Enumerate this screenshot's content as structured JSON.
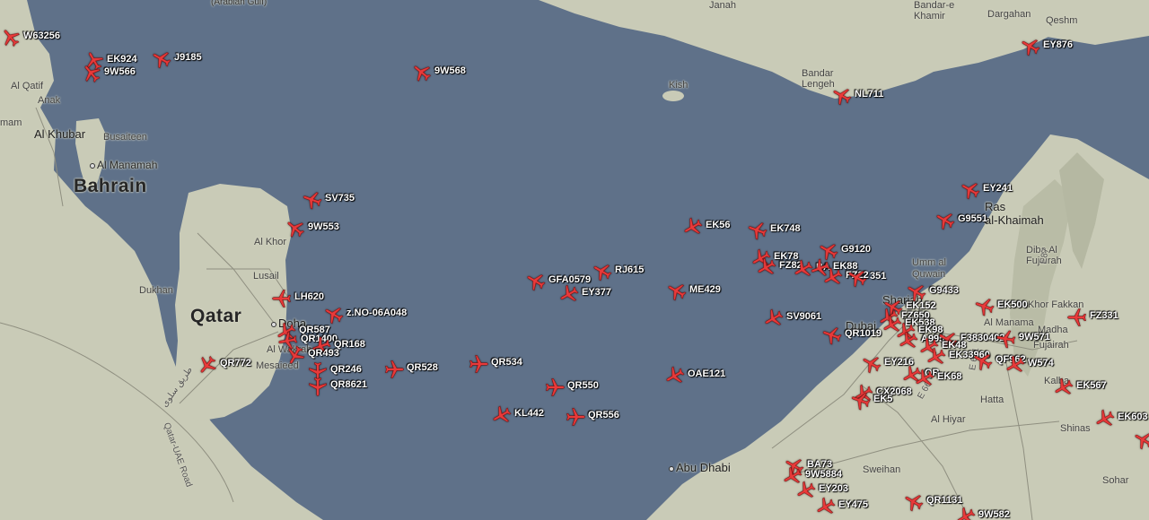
{
  "map": {
    "colors": {
      "water": "#5f7189",
      "land": "#c9cbb7",
      "plane": "#e83a3a",
      "label": "#ffffff"
    }
  },
  "places": [
    {
      "id": "arabian-gulf",
      "text": "(Arabian Gulf)",
      "cls": "sea"
    },
    {
      "id": "janah",
      "text": "Janah",
      "cls": "small"
    },
    {
      "id": "bandar-khamir",
      "text": "Bandar-e\nKhamir",
      "cls": "small"
    },
    {
      "id": "dargahan",
      "text": "Dargahan",
      "cls": "small"
    },
    {
      "id": "qeshm",
      "text": "Qeshm",
      "cls": "small"
    },
    {
      "id": "bandar-lengeh",
      "text": "Bandar\nLengeh",
      "cls": "small"
    },
    {
      "id": "kish",
      "text": "Kish",
      "cls": "small"
    },
    {
      "id": "al-qatif",
      "text": "Al Qatif",
      "cls": "small"
    },
    {
      "id": "anak",
      "text": "Anak",
      "cls": "small"
    },
    {
      "id": "mam",
      "text": "mam",
      "cls": "small"
    },
    {
      "id": "al-khubar",
      "text": "Al Khubar",
      "cls": "big"
    },
    {
      "id": "busaiteen",
      "text": "Busaiteen",
      "cls": "small"
    },
    {
      "id": "al-manamah",
      "text": "Al Manamah",
      "cls": "dot"
    },
    {
      "id": "bahrain",
      "text": "Bahrain",
      "cls": "country"
    },
    {
      "id": "al-khor",
      "text": "Al Khor",
      "cls": "small"
    },
    {
      "id": "lusail",
      "text": "Lusail",
      "cls": "small"
    },
    {
      "id": "dukhan",
      "text": "Dukhan",
      "cls": "small"
    },
    {
      "id": "qatar",
      "text": "Qatar",
      "cls": "country"
    },
    {
      "id": "doha",
      "text": "Doha",
      "cls": "dot"
    },
    {
      "id": "al-wakrah",
      "text": "Al Wakrah",
      "cls": "small"
    },
    {
      "id": "mesaieed",
      "text": "Mesaieed",
      "cls": "small"
    },
    {
      "id": "qatar-uae-road",
      "text": "Qatar-UAE Road",
      "cls": "road"
    },
    {
      "id": "arabic-road",
      "text": "طريق سلوى",
      "cls": "road"
    },
    {
      "id": "ras-al-khaimah",
      "text": "Ras\nal-Khaimah",
      "cls": "big"
    },
    {
      "id": "umm-al",
      "text": "Umm al\nQuwain",
      "cls": "small"
    },
    {
      "id": "dibba",
      "text": "Diba Al\nFujairah",
      "cls": "small"
    },
    {
      "id": "sharjah",
      "text": "Sharjah",
      "cls": "big"
    },
    {
      "id": "dubai",
      "text": "Dubai",
      "cls": "big"
    },
    {
      "id": "khor-fakkan",
      "text": "Khor Fakkan",
      "cls": "small"
    },
    {
      "id": "madha",
      "text": "Madha",
      "cls": "small"
    },
    {
      "id": "al-manama-uae",
      "text": "Al Manama",
      "cls": "small"
    },
    {
      "id": "fujairah",
      "text": "Fujairah",
      "cls": "small"
    },
    {
      "id": "kalba",
      "text": "Kalba",
      "cls": "small"
    },
    {
      "id": "hatta",
      "text": "Hatta",
      "cls": "small"
    },
    {
      "id": "shinas",
      "text": "Shinas",
      "cls": "small"
    },
    {
      "id": "sohar",
      "text": "Sohar",
      "cls": "small"
    },
    {
      "id": "abu-dhabi",
      "text": "Abu Dhabi",
      "cls": "dot big"
    },
    {
      "id": "al-hiyar",
      "text": "Al Hiyar",
      "cls": "small"
    },
    {
      "id": "sweihan",
      "text": "Sweihan",
      "cls": "small"
    },
    {
      "id": "e66",
      "text": "E 66",
      "cls": "road"
    },
    {
      "id": "e611",
      "text": "E 611",
      "cls": "road"
    },
    {
      "id": "e87",
      "text": "E87",
      "cls": "road"
    }
  ],
  "flights": [
    {
      "id": "W63256",
      "label": "W63256",
      "rot": -40
    },
    {
      "id": "EK924",
      "label": "EK924",
      "rot": -30
    },
    {
      "id": "9W566",
      "label": "9W566",
      "rot": -40
    },
    {
      "id": "J9185",
      "label": "J9185",
      "rot": -60
    },
    {
      "id": "9W568",
      "label": "9W568",
      "rot": -50
    },
    {
      "id": "NL711",
      "label": "NL711",
      "rot": -60
    },
    {
      "id": "EY876",
      "label": "EY876",
      "rot": -60
    },
    {
      "id": "SV735",
      "label": "SV735",
      "rot": -70
    },
    {
      "id": "9W553",
      "label": "9W553",
      "rot": -50
    },
    {
      "id": "LH620",
      "label": "LH620",
      "rot": -90
    },
    {
      "id": "z.NO-06A048",
      "label": "z.NO-06A048",
      "rot": -60
    },
    {
      "id": "QR587",
      "label": "QR587",
      "rot": -120
    },
    {
      "id": "QR1400",
      "label": "QR1400",
      "rot": -100
    },
    {
      "id": "QR168",
      "label": "QR168",
      "rot": -110
    },
    {
      "id": "QR493",
      "label": "QR493",
      "rot": -150
    },
    {
      "id": "QR772",
      "label": "QR772",
      "rot": -140
    },
    {
      "id": "QR246",
      "label": "QR246",
      "rot": -180
    },
    {
      "id": "QR8621",
      "label": "QR8621",
      "rot": -180
    },
    {
      "id": "QR528",
      "label": "QR528",
      "rot": 90
    },
    {
      "id": "QR534",
      "label": "QR534",
      "rot": 90
    },
    {
      "id": "GFA0579",
      "label": "GFA0579",
      "rot": -60
    },
    {
      "id": "RJ615",
      "label": "RJ615",
      "rot": -60
    },
    {
      "id": "EY377",
      "label": "EY377",
      "rot": -120
    },
    {
      "id": "QR550",
      "label": "QR550",
      "rot": 90
    },
    {
      "id": "KL442",
      "label": "KL442",
      "rot": -120
    },
    {
      "id": "QR556",
      "label": "QR556",
      "rot": 90
    },
    {
      "id": "ME429",
      "label": "ME429",
      "rot": -60
    },
    {
      "id": "OAE121",
      "label": "OAE121",
      "rot": -120
    },
    {
      "id": "EK56",
      "label": "EK56",
      "rot": -120
    },
    {
      "id": "EK748",
      "label": "EK748",
      "rot": -70
    },
    {
      "id": "EK78",
      "label": "EK78",
      "rot": -120
    },
    {
      "id": "FZ82",
      "label": "FZ82",
      "rot": -120
    },
    {
      "id": "BA",
      "label": "BA",
      "rot": -120
    },
    {
      "id": "EK88",
      "label": "EK88",
      "rot": -110
    },
    {
      "id": "G9120",
      "label": "G9120",
      "rot": -60
    },
    {
      "id": "FZ22",
      "label": "FZ22",
      "rot": -120
    },
    {
      "id": "351",
      "label": "351",
      "rot": -60
    },
    {
      "id": "EY241",
      "label": "EY241",
      "rot": -60
    },
    {
      "id": "G9551",
      "label": "G9551",
      "rot": -60
    },
    {
      "id": "G9433",
      "label": "G9433",
      "rot": -60
    },
    {
      "id": "EK500",
      "label": "EK500",
      "rot": -70
    },
    {
      "id": "FZ331",
      "label": "FZ331",
      "rot": -90
    },
    {
      "id": "SV9061",
      "label": "SV9061",
      "rot": -120
    },
    {
      "id": "EK152",
      "label": "EK152",
      "rot": -60
    },
    {
      "id": "FZ650",
      "label": "FZ650",
      "rot": -120
    },
    {
      "id": "EK538",
      "label": "EK538",
      "rot": -120
    },
    {
      "id": "QR1019",
      "label": "QR1019",
      "rot": -70
    },
    {
      "id": "EK98",
      "label": "EK98",
      "rot": -120
    },
    {
      "id": "A995",
      "label": "A995",
      "rot": -120
    },
    {
      "id": "F3830402",
      "label": "F3830402",
      "rot": -60
    },
    {
      "id": "9W571",
      "label": "9W571",
      "rot": -80
    },
    {
      "id": "EK48",
      "label": "EK48",
      "rot": -120
    },
    {
      "id": "EK33960",
      "label": "EK33960",
      "rot": -120
    },
    {
      "id": "QF962",
      "label": "QF962",
      "rot": -60
    },
    {
      "id": "W574",
      "label": "W574",
      "rot": -120
    },
    {
      "id": "EY216",
      "label": "EY216",
      "rot": -60
    },
    {
      "id": "QR",
      "label": "QR",
      "rot": -120
    },
    {
      "id": "EK68",
      "label": "EK68",
      "rot": -120
    },
    {
      "id": "EK567",
      "label": "EK567",
      "rot": -120
    },
    {
      "id": "EK603",
      "label": "EK603",
      "rot": -120
    },
    {
      "id": "CX2068",
      "label": "CX2068",
      "rot": -120
    },
    {
      "id": "EK5",
      "label": "EK5",
      "rot": -70
    },
    {
      "id": "BA73",
      "label": "BA73",
      "rot": -60
    },
    {
      "id": "9W5884",
      "label": "9W5884",
      "rot": -120
    },
    {
      "id": "EY203",
      "label": "EY203",
      "rot": -120
    },
    {
      "id": "EY475",
      "label": "EY475",
      "rot": -120
    },
    {
      "id": "QR1131",
      "label": "QR1131",
      "rot": -60
    },
    {
      "id": "9W582",
      "label": "9W582",
      "rot": -120
    },
    {
      "id": "last-east",
      "label": "",
      "rot": -60
    }
  ]
}
